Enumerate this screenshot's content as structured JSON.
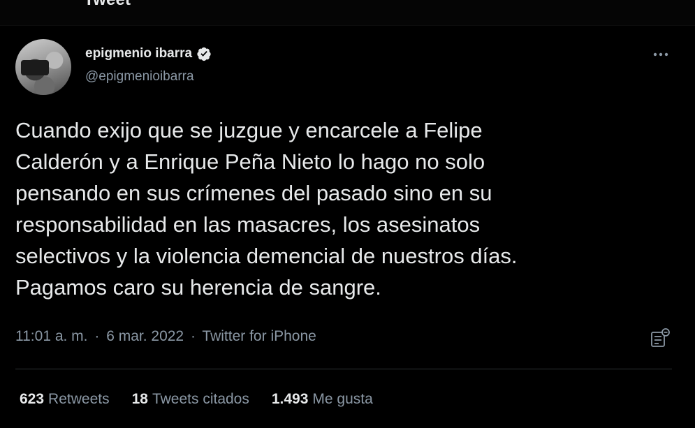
{
  "header": {
    "title": "Tweet"
  },
  "tweet": {
    "author": {
      "display_name": "epigmenio ibarra",
      "handle": "@epigmenioibarra",
      "verified": true
    },
    "more_icon": "more-dots-icon",
    "text": "Cuando exijo que se juzgue y encarcele a Felipe\nCalderón y a Enrique Peña Nieto lo hago no solo\npensando en sus crímenes del pasado sino en su\nresponsabilidad en las masacres, los asesinatos\nselectivos y la violencia demencial de nuestros días.\nPagamos caro su herencia de sangre.",
    "time": "11:01 a. m.",
    "separator": "·",
    "date": "6 mar. 2022",
    "source": "Twitter for iPhone",
    "analytics_icon": "analytics-icon",
    "stats": [
      {
        "count": "623",
        "label": "Retweets"
      },
      {
        "count": "18",
        "label": "Tweets citados"
      },
      {
        "count": "1.493",
        "label": "Me gusta"
      }
    ]
  },
  "colors": {
    "background": "#000000",
    "text": "#e7e9ea",
    "secondary": "#8b98a5",
    "divider": "#2f3336"
  }
}
